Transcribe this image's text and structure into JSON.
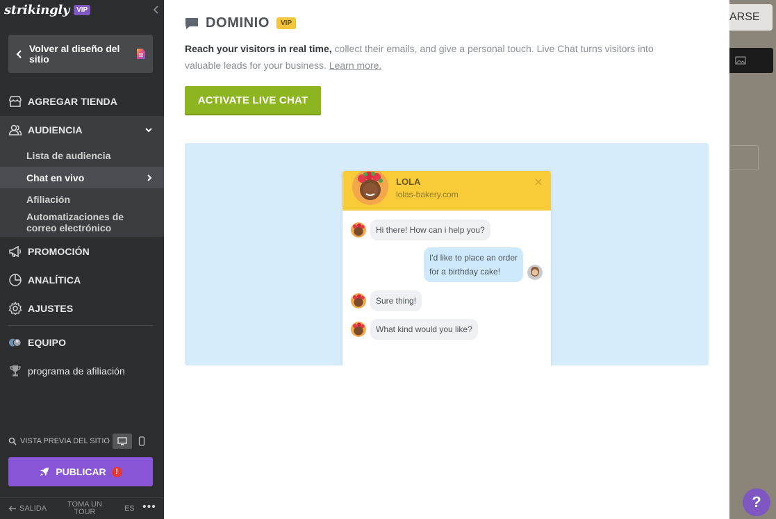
{
  "sidebar": {
    "brand": "strikingly",
    "vip": "VIP",
    "back_label": "Volver al diseño del sitio",
    "nav": {
      "store": "AGREGAR TIENDA",
      "audience": "AUDIENCIA",
      "promotion": "PROMOCIÓN",
      "analytics": "ANALÍTICA",
      "settings": "AJUSTES",
      "team": "EQUIPO",
      "affiliate": "programa de afiliación"
    },
    "audience_sub": {
      "list": "Lista de audiencia",
      "live_chat": "Chat en vivo",
      "affiliation": "Afiliación",
      "automations": "Automatizaciones de correo electrónico"
    },
    "preview_label": "VISTA PREVIA DEL SITIO",
    "publish_label": "PUBLICAR",
    "publish_alert": "!",
    "footer": {
      "exit": "SALIDA",
      "tour": "TOMA UN TOUR",
      "lang": "ES",
      "more": "•••"
    }
  },
  "panel": {
    "title": "DOMINIO",
    "vip": "VIP",
    "desc_bold": "Reach your visitors in real time,",
    "desc_rest": " collect their emails, and give a personal touch. Live Chat turns visitors into valuable leads for your business. ",
    "learn_more": "Learn more.",
    "activate_label": "ACTIVATE LIVE CHAT"
  },
  "chat_preview": {
    "agent_name": "LOLA",
    "agent_site": "lolas-bakery.com",
    "messages": [
      {
        "from": "agent",
        "text": "Hi there! How can i help you?"
      },
      {
        "from": "user",
        "text_line1": "I'd like to place an order",
        "text_line2": "for a birthday cake!"
      },
      {
        "from": "agent",
        "text": "Sure thing!"
      },
      {
        "from": "agent",
        "text": "What kind would you like?"
      }
    ]
  },
  "background": {
    "save_label": "ARSE",
    "help_label": "?"
  },
  "colors": {
    "sidebar_bg": "#2d2e30",
    "accent_purple": "#8755d6",
    "activate_green": "#8db520",
    "chat_yellow": "#f9cb38",
    "preview_blue": "#d6ecfb"
  }
}
